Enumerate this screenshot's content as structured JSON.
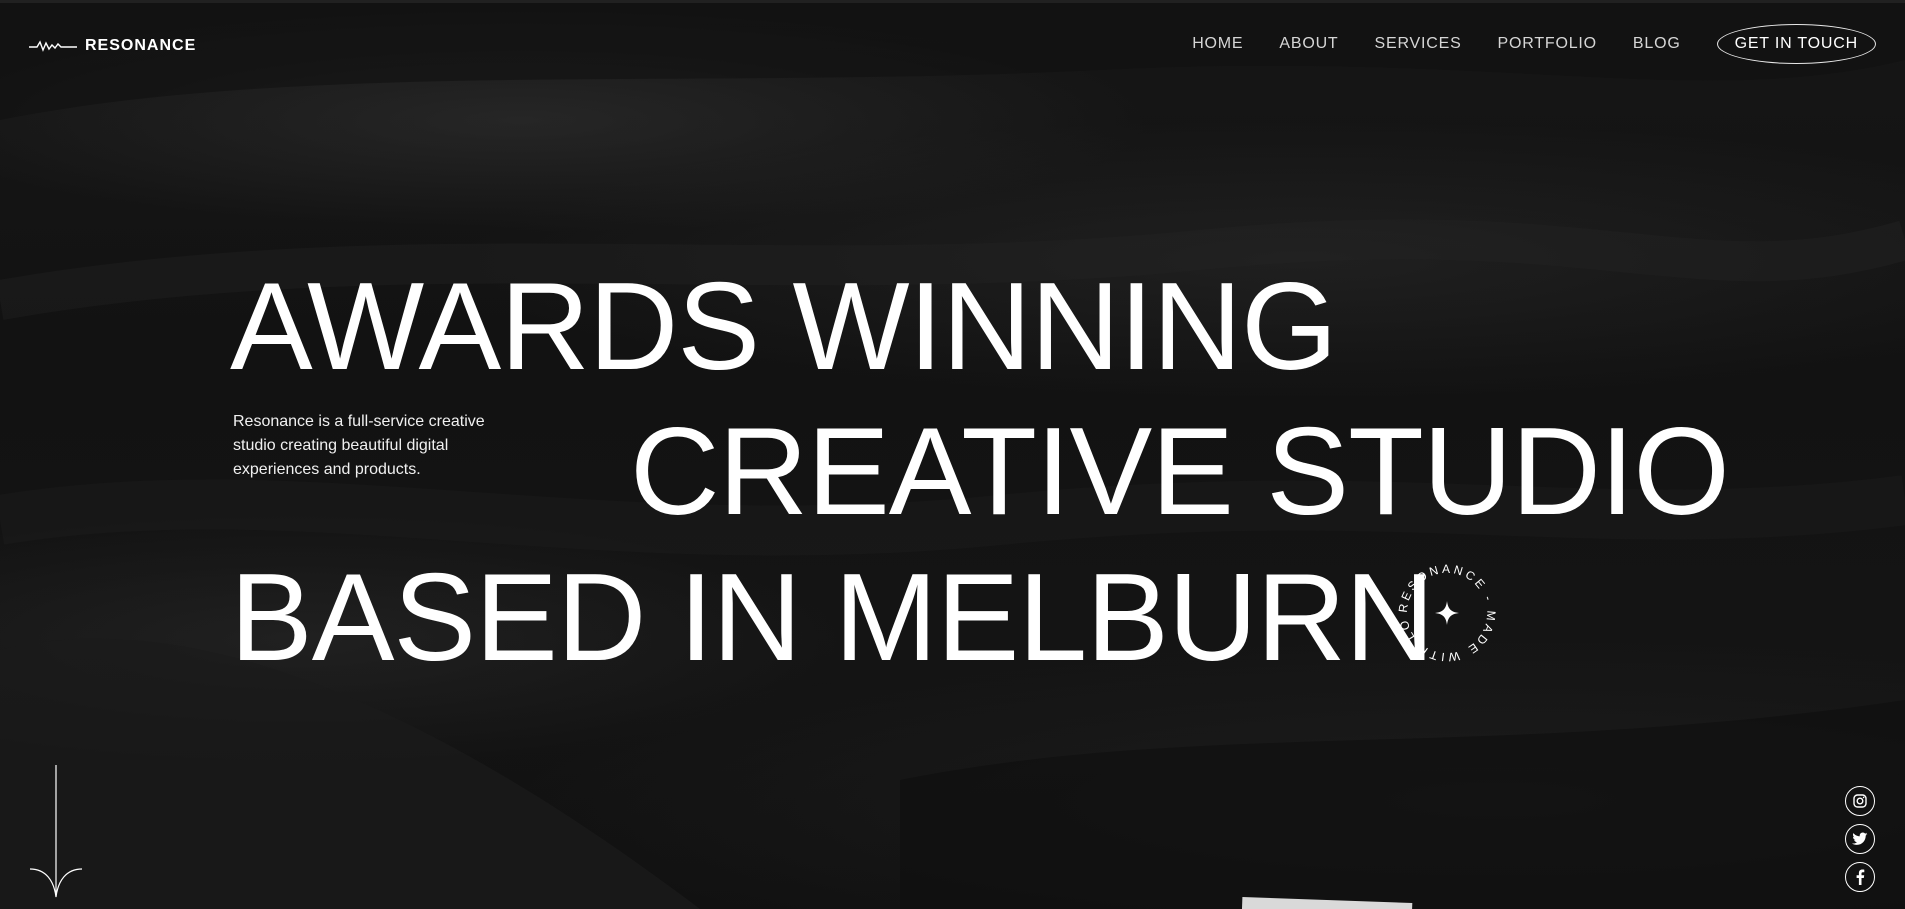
{
  "header": {
    "logo_text": "RESONANCE",
    "nav": {
      "home": "HOME",
      "about": "ABOUT",
      "services": "SERVICES",
      "portfolio": "PORTFOLIO",
      "blog": "BLOG"
    },
    "cta_label": "GET IN TOUCH"
  },
  "hero": {
    "line1": "AWARDS WINNING",
    "line2": "CREATIVE STUDIO",
    "line3": "BASED IN MELBURN",
    "intro": "Resonance is a full-service creative studio creating beautiful digital experiences and products.",
    "badge_text": "RESONANCE - MADE WITH LOVE -"
  },
  "social": {
    "instagram_icon": "instagram-icon",
    "twitter_icon": "twitter-icon",
    "facebook_icon": "facebook-icon"
  },
  "colors": {
    "background": "#141414",
    "text": "#ffffff",
    "nav_text": "#d6d6d6"
  }
}
